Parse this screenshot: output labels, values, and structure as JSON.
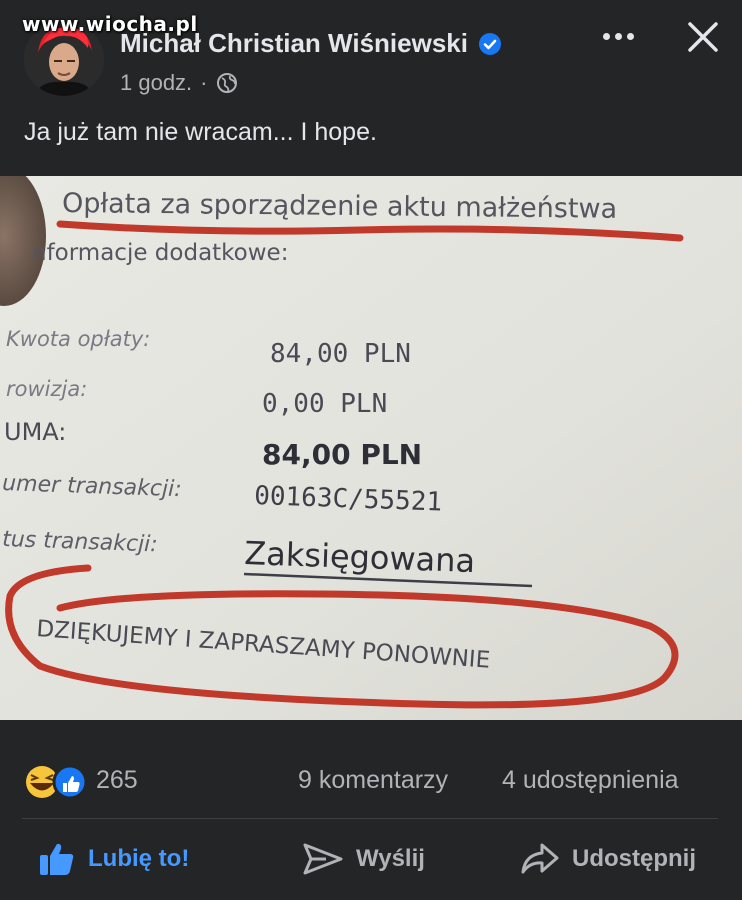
{
  "watermark": "www.wiocha.pl",
  "post": {
    "author": "Michał Christian Wiśniewski",
    "time": "1 godz.",
    "separator": "·",
    "text": "Ja już tam nie wracam... I hope."
  },
  "photo": {
    "title": "Opłata za sporządzenie aktu małżeństwa",
    "section": "nformacje dodatkowe:",
    "rows": [
      {
        "label": "Kwota opłaty:",
        "value": "84,00 PLN"
      },
      {
        "label": "rowizja:",
        "value": "0,00 PLN"
      },
      {
        "label": "UMA:",
        "value": "84,00 PLN"
      },
      {
        "label": "umer transakcji:",
        "value": "00163C/55521"
      },
      {
        "label": "tus transakcji:",
        "value": "Zaksięgowana"
      }
    ],
    "footer": "DZIĘKUJEMY I ZAPRASZAMY PONOWNIE"
  },
  "stats": {
    "reactions_count": "265",
    "comments": "9 komentarzy",
    "shares": "4 udostępnienia"
  },
  "actions": {
    "like": "Lubię to!",
    "send": "Wyślij",
    "share": "Udostępnij"
  },
  "colors": {
    "background": "#242526",
    "text_primary": "#e4e6eb",
    "text_secondary": "#b0b3b8",
    "like_blue": "#4599ff",
    "verified_blue": "#1877f2",
    "marker_red": "#c0392b"
  }
}
